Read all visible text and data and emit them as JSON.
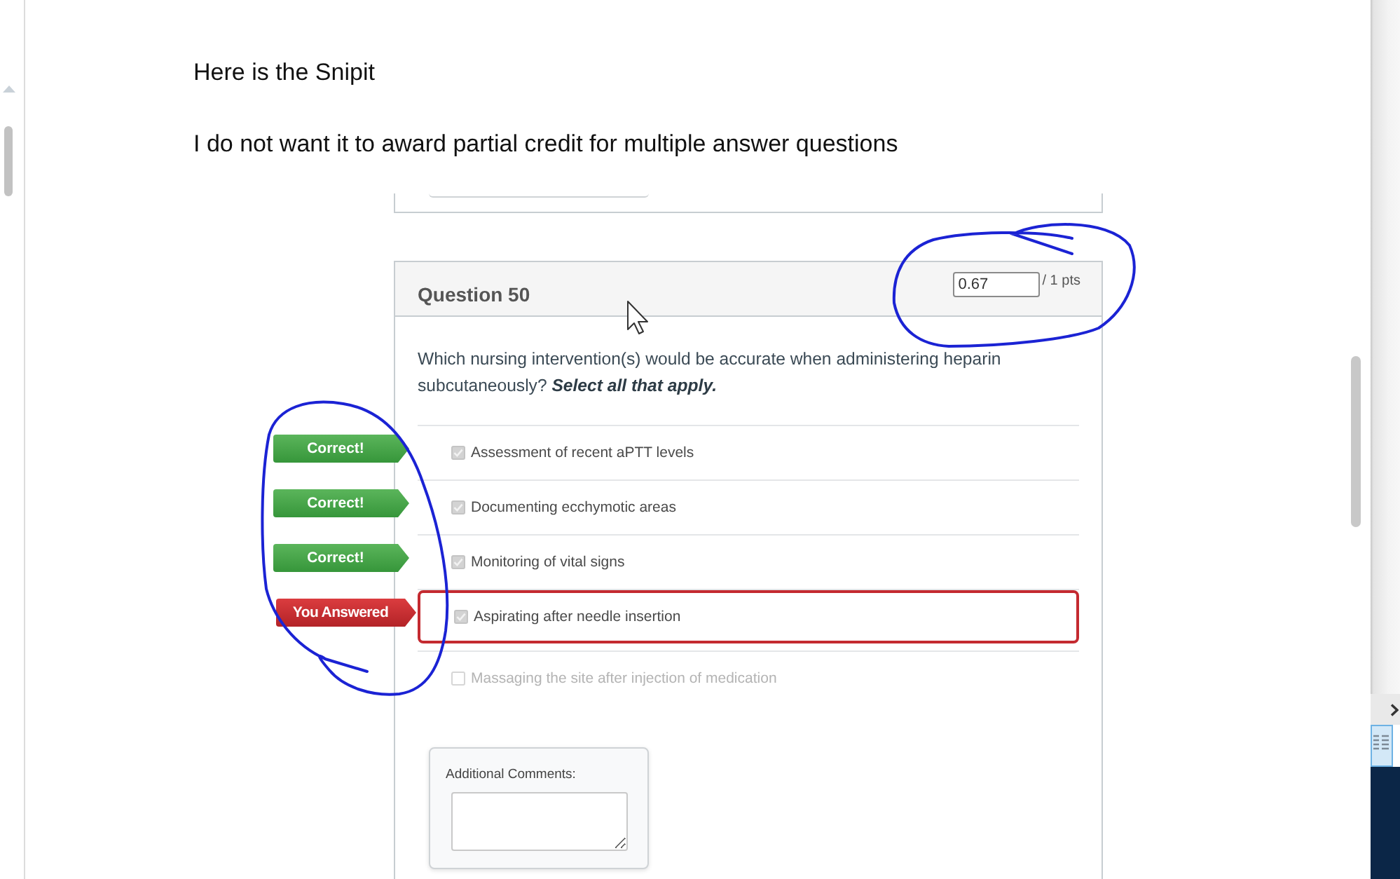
{
  "post": {
    "paragraphs": [
      "Here is the Snipit",
      "I do not want it to award partial credit for multiple answer questions"
    ]
  },
  "quiz_snippet": {
    "question": {
      "title": "Question 50",
      "score": {
        "value": "0.67",
        "total": "/ 1 pts"
      },
      "text": "Which nursing intervention(s) would be accurate when administering heparin subcutaneously? **Select all that apply.**",
      "answers": [
        {
          "text": "Assessment of recent aPTT levels",
          "checked": true,
          "result": {
            "kind": "correct",
            "label": "Correct!"
          }
        },
        {
          "text": "Documenting ecchymotic areas",
          "checked": true,
          "result": {
            "kind": "correct",
            "label": "Correct!"
          }
        },
        {
          "text": "Monitoring of vital signs",
          "checked": true,
          "result": {
            "kind": "correct",
            "label": "Correct!"
          }
        },
        {
          "text": "Aspirating after needle insertion",
          "checked": true,
          "result": {
            "kind": "you_answered",
            "label": "You Answered"
          }
        },
        {
          "text": "Massaging the site after injection of medication",
          "checked": false
        }
      ],
      "comments": {
        "label": "Additional Comments:"
      }
    }
  }
}
